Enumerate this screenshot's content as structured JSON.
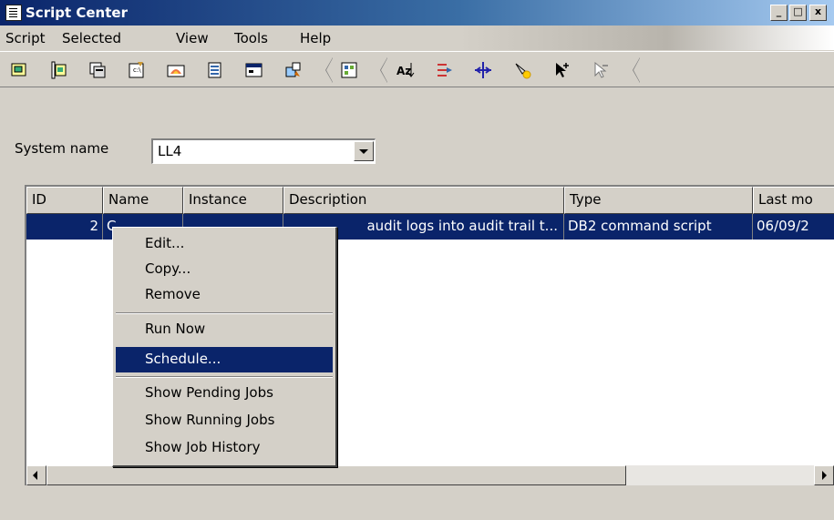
{
  "window": {
    "title": "Script Center",
    "controls": [
      "_",
      "□",
      "x"
    ]
  },
  "menubar": [
    "Script",
    "Selected",
    "View",
    "Tools",
    "Help"
  ],
  "toolbar": {
    "icons": [
      "new-script-icon",
      "new-folder-icon",
      "import-icon",
      "edit-icon",
      "run-icon",
      "schedule-icon",
      "properties-icon",
      "refresh-icon",
      "config-icon",
      "sort-icon",
      "filter-icon",
      "move-icon",
      "search-icon",
      "pointer-add-icon",
      "pointer-remove-icon"
    ]
  },
  "system": {
    "label": "System name",
    "value": "LL4"
  },
  "table": {
    "columns": [
      "ID",
      "Name",
      "Instance",
      "Description",
      "Type",
      "Last mo"
    ],
    "rows": [
      {
        "id": "2",
        "name": "C",
        "instance": "",
        "description": "audit logs into audit trail t...",
        "type": "DB2 command script",
        "last_modified": "06/09/2"
      }
    ]
  },
  "context_menu": {
    "items": [
      {
        "label": "Edit...",
        "selected": false
      },
      {
        "label": "Copy...",
        "selected": false
      },
      {
        "label": "Remove",
        "selected": false
      },
      {
        "label": "Run Now",
        "selected": false
      },
      {
        "label": "Schedule...",
        "selected": true
      },
      {
        "label": "Show Pending Jobs",
        "selected": false
      },
      {
        "label": "Show Running Jobs",
        "selected": false
      },
      {
        "label": "Show Job History",
        "selected": false
      }
    ]
  },
  "colors": {
    "selection": "#0a246a",
    "face": "#d4d0c8",
    "title_start": "#0a246a"
  }
}
